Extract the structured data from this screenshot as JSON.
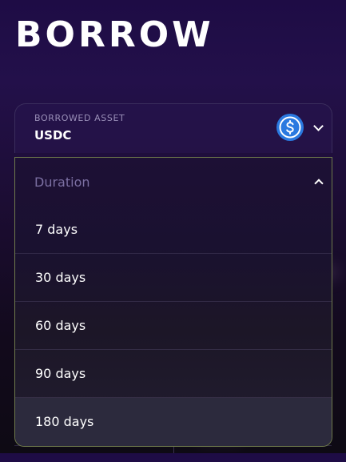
{
  "page": {
    "title": "BORROW"
  },
  "asset_select": {
    "label": "BORROWED ASSET",
    "value": "USDC",
    "icon": "usdc-coin-icon",
    "icon_color": "#2a79e0"
  },
  "duration_dropdown": {
    "title": "Duration",
    "expanded": true,
    "options": [
      {
        "label": "7 days"
      },
      {
        "label": "30 days"
      },
      {
        "label": "60 days"
      },
      {
        "label": "90 days"
      },
      {
        "label": "180 days"
      }
    ],
    "highlighted_option": "180 days",
    "border_color": "#6f7a4c"
  }
}
